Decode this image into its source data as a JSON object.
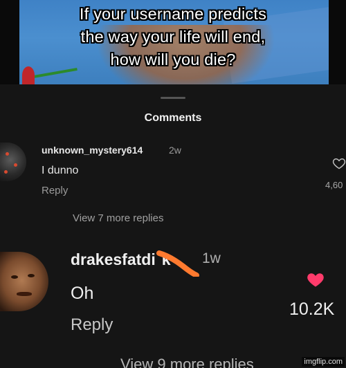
{
  "video": {
    "caption_lines": [
      "If your username predicts",
      "the way your life will end,",
      "how will you die?"
    ]
  },
  "sheet": {
    "title": "Comments"
  },
  "comments": [
    {
      "username": "unknown_mystery614",
      "time": "2w",
      "text": "I dunno",
      "reply_label": "Reply",
      "likes": "4,60",
      "view_more": "View 7 more replies",
      "liked": false
    },
    {
      "username": "drakesfatdi",
      "username_tail": "k",
      "time": "1w",
      "text": "Oh",
      "reply_label": "Reply",
      "likes": "10.2K",
      "view_more": "View 9 more replies",
      "liked": true
    }
  ],
  "colors": {
    "background": "#151515",
    "like_active": "#ff3b6b",
    "censor_scribble": "#ff7a2f"
  },
  "watermark": "imgflip.com"
}
